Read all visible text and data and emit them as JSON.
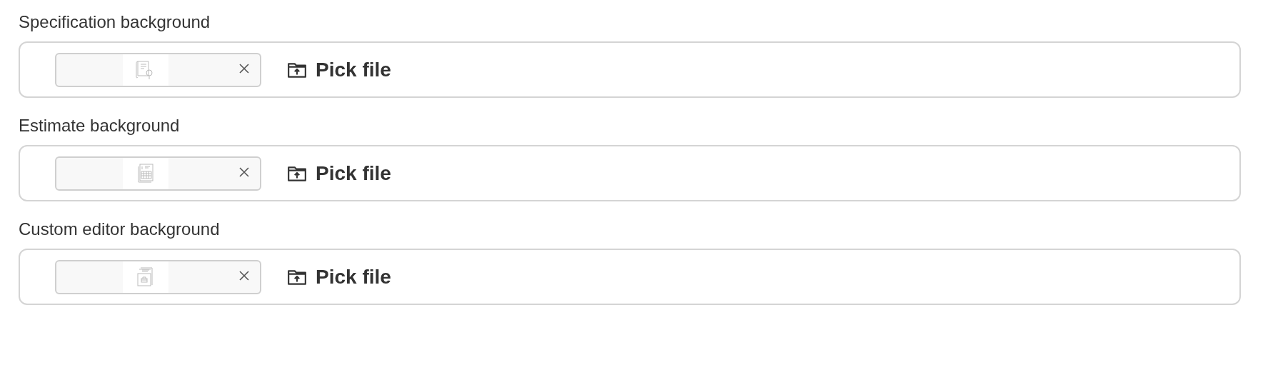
{
  "fields": [
    {
      "label": "Specification background",
      "preview": {
        "kind": "document-search"
      },
      "button": "Pick file"
    },
    {
      "label": "Estimate background",
      "preview": {
        "kind": "spreadsheet"
      },
      "button": "Pick file"
    },
    {
      "label": "Custom editor background",
      "preview": {
        "kind": "briefcase-document"
      },
      "button": "Pick file"
    }
  ]
}
